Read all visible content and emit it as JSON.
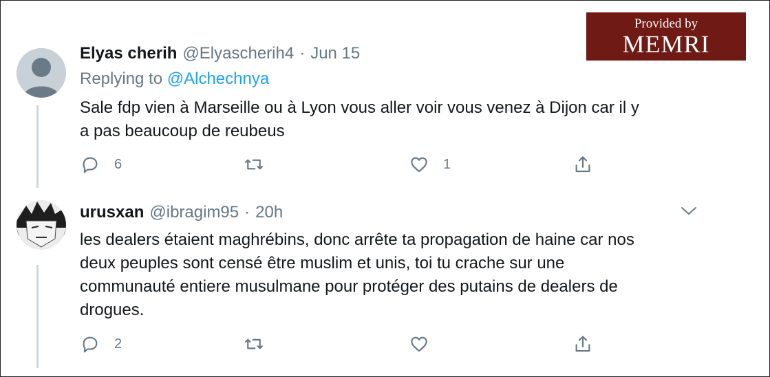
{
  "watermark": {
    "line1": "Provided by",
    "line2": "MEMRI"
  },
  "tweets": [
    {
      "author_name": "Elyas cherih",
      "handle": "@Elyascherih4",
      "time": "Jun 15",
      "replying_prefix": "Replying to",
      "replying_to": "@Alchechnya",
      "text_line1": "Sale fdp vien à Marseille ou à Lyon vous aller voir vous venez à Dijon car il y",
      "text_line2": "a pas beaucoup de reubeus",
      "reply_count": "6",
      "retweet_count": "",
      "like_count": "1"
    },
    {
      "author_name": "urusxan",
      "handle": "@ibragim95",
      "time": "20h",
      "text_line1": "les dealers étaient maghrébins, donc arrête ta propagation de haine car nos",
      "text_line2": "deux peuples sont censé être muslim et unis, toi tu crache sur une",
      "text_line3": "communauté entiere musulmane pour protéger des putains de dealers de",
      "text_line4": "drogues.",
      "reply_count": "2",
      "retweet_count": "",
      "like_count": ""
    }
  ],
  "icons": {
    "reply": "reply-icon",
    "retweet": "retweet-icon",
    "like": "heart-icon",
    "share": "share-icon",
    "more": "chevron-down-icon"
  },
  "colors": {
    "text": "#14171a",
    "muted": "#657786",
    "link": "#1da1f2",
    "watermark_bg": "#6f1a14"
  }
}
